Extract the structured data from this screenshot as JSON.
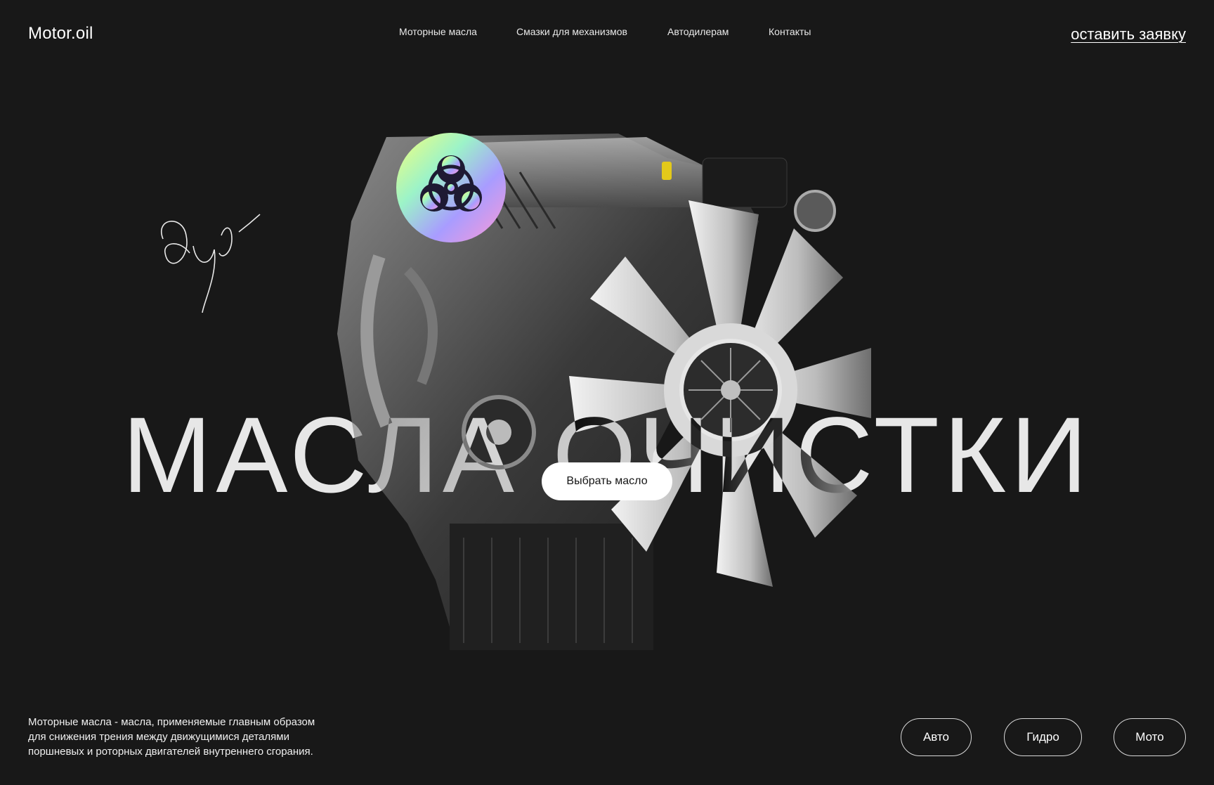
{
  "header": {
    "logo": "Motor.oil",
    "nav": [
      {
        "label": "Моторные масла"
      },
      {
        "label": "Смазки для механизмов"
      },
      {
        "label": "Автодилерам"
      },
      {
        "label": "Контакты"
      }
    ],
    "cta_label": "оставить заявку"
  },
  "hero": {
    "headline": "МАСЛА ОЧИСТКИ",
    "button_label": "Выбрать масло",
    "sticker_icon": "biohazard-icon",
    "image_icon": "engine-illustration"
  },
  "footer": {
    "description_lines": [
      "Моторные масла - масла, применяемые главным образом",
      "для снижения трения между движущимися деталями",
      "поршневых и роторных двигателей внутреннего сгорания."
    ],
    "categories": [
      "Авто",
      "Гидро",
      "Мото"
    ]
  },
  "colors": {
    "background": "#181818",
    "text": "#ffffff",
    "button_bg": "#ffffff",
    "button_text": "#151515"
  }
}
